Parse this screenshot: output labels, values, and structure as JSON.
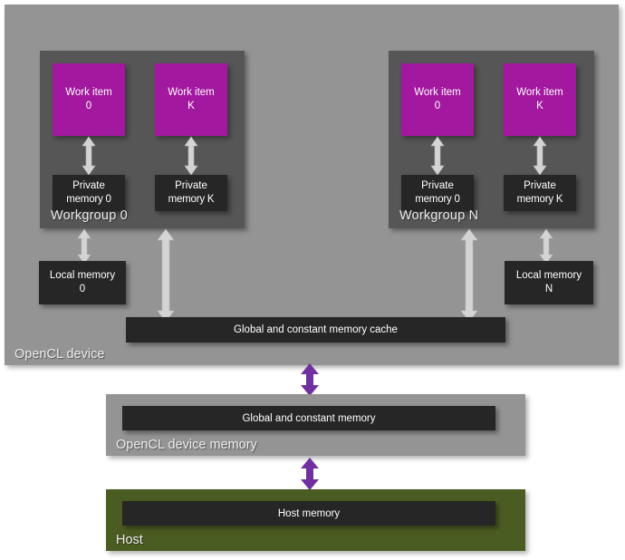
{
  "device": {
    "label": "OpenCL device",
    "bg_color": "#949494"
  },
  "workgroups": [
    {
      "label": "Workgroup  0",
      "work_items": [
        {
          "line1": "Work item",
          "line2": "0"
        },
        {
          "line1": "Work item",
          "line2": "K"
        }
      ],
      "private_memories": [
        {
          "line1": "Private",
          "line2": "memory 0"
        },
        {
          "line1": "Private",
          "line2": "memory K"
        }
      ],
      "local_memory": {
        "line1": "Local memory",
        "line2": "0"
      }
    },
    {
      "label": "Workgroup  N",
      "work_items": [
        {
          "line1": "Work item",
          "line2": "0"
        },
        {
          "line1": "Work item",
          "line2": "K"
        }
      ],
      "private_memories": [
        {
          "line1": "Private",
          "line2": "memory 0"
        },
        {
          "line1": "Private",
          "line2": "memory K"
        }
      ],
      "local_memory": {
        "line1": "Local memory",
        "line2": "N"
      }
    }
  ],
  "cache_bar": {
    "label": "Global and constant memory cache"
  },
  "device_memory": {
    "panel_label": "OpenCL device memory",
    "bar_label": "Global and constant memory"
  },
  "host": {
    "panel_label": "Host",
    "bar_label": "Host memory",
    "bg_color": "#4b5c22"
  },
  "colors": {
    "work_item": "#a2189e",
    "memory_block": "#262626",
    "workgroup_panel": "#565656",
    "device_panel": "#949494",
    "host_panel": "#4b5c22",
    "white_arrow": "#d4d4d4",
    "purple_arrow": "#7030a0"
  },
  "arrows": {
    "white_double": "double-headed-arrow-white",
    "white_up": "up-arrow-white",
    "white_down": "down-arrow-white",
    "purple_double": "double-headed-arrow-purple"
  }
}
